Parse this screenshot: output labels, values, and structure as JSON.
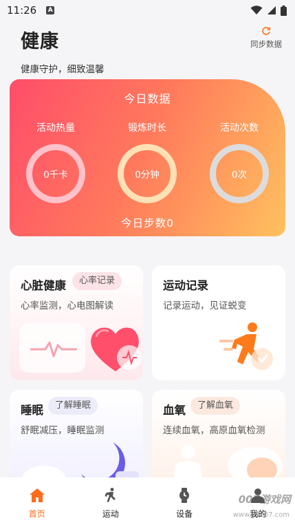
{
  "status_bar": {
    "time": "11:26",
    "notification_letter": "A"
  },
  "header": {
    "title": "健康",
    "subtitle": "健康守护，细致温馨",
    "sync_label": "同步数据"
  },
  "today": {
    "title": "今日数据",
    "metrics": [
      {
        "label": "活动热量",
        "value": "0千卡",
        "ring_color": "#ffc2cb"
      },
      {
        "label": "锻炼时长",
        "value": "0分钟",
        "ring_color": "#ffe1b5"
      },
      {
        "label": "活动次数",
        "value": "0次",
        "ring_color": "#dcdcdc"
      }
    ],
    "steps": "今日步数0"
  },
  "cards": {
    "heart": {
      "title": "心脏健康",
      "tag": "心率记录",
      "desc": "心率监测，心电图解读"
    },
    "exercise": {
      "title": "运动记录",
      "desc": "记录运动，见证蜕变"
    },
    "sleep": {
      "title": "睡眠",
      "tag": "了解睡眠",
      "desc": "舒眠减压，睡眠监测"
    },
    "spo2": {
      "title": "血氧",
      "tag": "了解血氧",
      "desc": "连续血氧，高原血氧检测"
    }
  },
  "nav": [
    {
      "label": "首页",
      "icon": "home-icon"
    },
    {
      "label": "运动",
      "icon": "runner-icon"
    },
    {
      "label": "设备",
      "icon": "watch-icon"
    },
    {
      "label": "我的",
      "icon": "person-icon"
    }
  ],
  "watermark": {
    "text": "007游戏网",
    "url": "www.yx007.com"
  },
  "colors": {
    "accent": "#ff6b1a",
    "gradient_start": "#ff4d6a",
    "gradient_end": "#ffc15e"
  }
}
